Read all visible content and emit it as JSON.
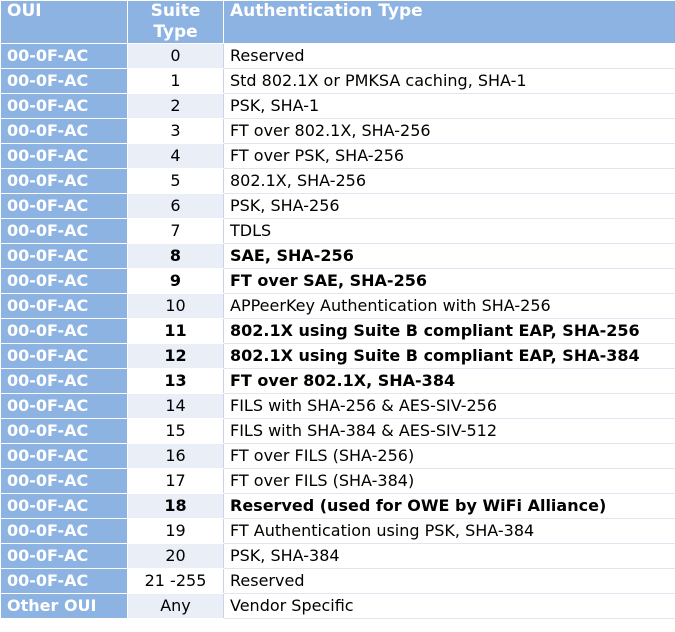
{
  "headers": {
    "oui": "OUI",
    "suite_type": "Suite Type",
    "auth_type": "Authentication Type"
  },
  "colors": {
    "header_blue": "#8db3e2",
    "purple": "#7030a0",
    "green": "#00b050",
    "blue": "#0070c0"
  },
  "rows": [
    {
      "oui": "00-0F-AC",
      "suite": "0",
      "auth": "Reserved",
      "style": ""
    },
    {
      "oui": "00-0F-AC",
      "suite": "1",
      "auth": "Std 802.1X or PMKSA caching, SHA-1",
      "style": ""
    },
    {
      "oui": "00-0F-AC",
      "suite": "2",
      "auth": "PSK, SHA-1",
      "style": ""
    },
    {
      "oui": "00-0F-AC",
      "suite": "3",
      "auth": "FT over 802.1X, SHA-256",
      "style": ""
    },
    {
      "oui": "00-0F-AC",
      "suite": "4",
      "auth": "FT over PSK, SHA-256",
      "style": ""
    },
    {
      "oui": "00-0F-AC",
      "suite": "5",
      "auth": "802.1X, SHA-256",
      "style": ""
    },
    {
      "oui": "00-0F-AC",
      "suite": "6",
      "auth": "PSK, SHA-256",
      "style": ""
    },
    {
      "oui": "00-0F-AC",
      "suite": "7",
      "auth": "TDLS",
      "style": ""
    },
    {
      "oui": "00-0F-AC",
      "suite": "8",
      "auth": "SAE, SHA-256",
      "style": "purple"
    },
    {
      "oui": "00-0F-AC",
      "suite": "9",
      "auth": "FT over SAE, SHA-256",
      "style": "purple"
    },
    {
      "oui": "00-0F-AC",
      "suite": "10",
      "auth": "APPeerKey Authentication with SHA-256",
      "style": ""
    },
    {
      "oui": "00-0F-AC",
      "suite": "11",
      "auth": "802.1X using Suite B compliant EAP, SHA-256",
      "style": "green"
    },
    {
      "oui": "00-0F-AC",
      "suite": "12",
      "auth": "802.1X using Suite B compliant EAP, SHA-384",
      "style": "green"
    },
    {
      "oui": "00-0F-AC",
      "suite": "13",
      "auth": "FT over 802.1X, SHA-384",
      "style": "green"
    },
    {
      "oui": "00-0F-AC",
      "suite": "14",
      "auth": "FILS with SHA-256 & AES-SIV-256",
      "style": ""
    },
    {
      "oui": "00-0F-AC",
      "suite": "15",
      "auth": "FILS with SHA-384 & AES-SIV-512",
      "style": ""
    },
    {
      "oui": "00-0F-AC",
      "suite": "16",
      "auth": "FT over FILS (SHA-256)",
      "style": ""
    },
    {
      "oui": "00-0F-AC",
      "suite": "17",
      "auth": "FT over FILS (SHA-384)",
      "style": ""
    },
    {
      "oui": "00-0F-AC",
      "suite": "18",
      "auth": "Reserved (used for OWE by WiFi Alliance)",
      "style": "blue"
    },
    {
      "oui": "00-0F-AC",
      "suite": "19",
      "auth": "FT Authentication using PSK, SHA-384",
      "style": ""
    },
    {
      "oui": "00-0F-AC",
      "suite": "20",
      "auth": "PSK, SHA-384",
      "style": ""
    },
    {
      "oui": "00-0F-AC",
      "suite": "21 -255",
      "auth": "Reserved",
      "style": ""
    },
    {
      "oui": "Other OUI",
      "suite": "Any",
      "auth": "Vendor Specific",
      "style": ""
    }
  ]
}
